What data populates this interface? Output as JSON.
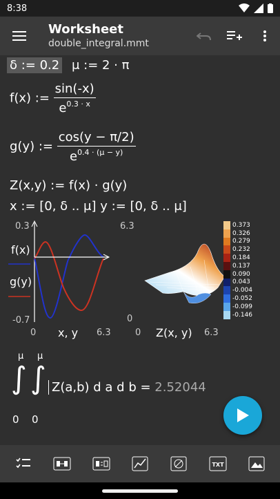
{
  "status": {
    "time": "8:38"
  },
  "app": {
    "title": "Worksheet",
    "file": "double_integral.mmt"
  },
  "worksheet": {
    "delta_def": "δ := 0.2",
    "mu_def": "μ := 2 · π",
    "f_lhs": "f(x) :=",
    "f_num": "sin(-x)",
    "f_den_base": "e",
    "f_den_exp": "0.3 · x",
    "g_lhs": "g(y) :=",
    "g_num": "cos(y − π/2)",
    "g_den_base": "e",
    "g_den_exp": "0.4 · (μ − y)",
    "z_def": "Z(x,y) := f(x) · g(y)",
    "ranges_def": "x := [0, δ .. μ]   y := [0, δ .. μ]",
    "integral_upper1": "μ",
    "integral_upper2": "μ",
    "integral_lower1": "0",
    "integral_lower2": "0",
    "integrand": "Z(a,b) d a d b =",
    "integral_result": "2.52044"
  },
  "plot2d": {
    "y_max": "0.3",
    "y_min": "-0.7",
    "x_min": "0",
    "x_max": "6.3",
    "x_label": "x, y",
    "series": [
      {
        "name": "f(x)",
        "color": "#2233cc"
      },
      {
        "name": "g(y)",
        "color": "#cc3322"
      }
    ]
  },
  "plot3d": {
    "x_min": "0",
    "x_max": "6.3",
    "y_max": "6.3",
    "label": "Z(x, y)",
    "legend": [
      {
        "value": "0.373",
        "color": "#f3c98a"
      },
      {
        "value": "0.326",
        "color": "#efa24e"
      },
      {
        "value": "0.279",
        "color": "#e07a20"
      },
      {
        "value": "0.232",
        "color": "#c94a1a"
      },
      {
        "value": "0.184",
        "color": "#a82314"
      },
      {
        "value": "0.137",
        "color": "#5a1010"
      },
      {
        "value": "0.090",
        "color": "#111111"
      },
      {
        "value": "0.043",
        "color": "#10206a"
      },
      {
        "value": "-0.004",
        "color": "#1c44b0"
      },
      {
        "value": "-0.052",
        "color": "#2f6ee0"
      },
      {
        "value": "-0.099",
        "color": "#5aa6ea"
      },
      {
        "value": "-0.146",
        "color": "#a8d8f2"
      }
    ]
  },
  "toolbar": {
    "items": [
      "checklist-icon",
      "range-icon",
      "equation-icon",
      "plot-icon",
      "no-pen-icon",
      "txt-icon",
      "image-icon"
    ],
    "txt_label": "TXT"
  },
  "fab": {
    "icon": "play-icon"
  }
}
